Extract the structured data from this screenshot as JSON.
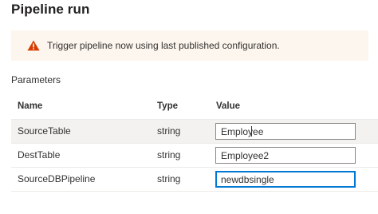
{
  "panel": {
    "title": "Pipeline run"
  },
  "warning": {
    "icon": "warning-triangle-icon",
    "icon_color": "#d83b01",
    "text": "Trigger pipeline now using last published configuration."
  },
  "parameters": {
    "section_label": "Parameters",
    "columns": {
      "name": "Name",
      "type": "Type",
      "value": "Value"
    },
    "rows": [
      {
        "name": "SourceTable",
        "type": "string",
        "value": "Employee"
      },
      {
        "name": "DestTable",
        "type": "string",
        "value": "Employee2"
      },
      {
        "name": "SourceDBPipeline",
        "type": "string",
        "value": "newdbsingle"
      }
    ]
  },
  "colors": {
    "focus_border": "#0078d4",
    "banner_bg": "#fdf6ee",
    "selected_row_bg": "#f3f2f1"
  }
}
